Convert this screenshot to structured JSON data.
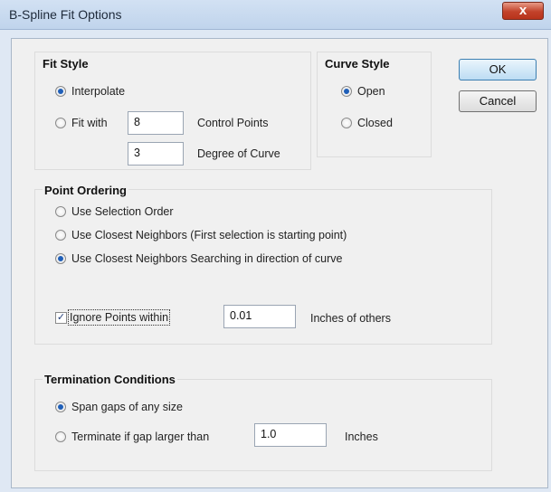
{
  "window": {
    "title": "B-Spline Fit Options",
    "close_label": "x"
  },
  "fit_style": {
    "title": "Fit Style",
    "interpolate_label": "Interpolate",
    "fit_with_label": "Fit with",
    "control_points_value": "8",
    "control_points_label": "Control Points",
    "degree_value": "3",
    "degree_label": "Degree of Curve",
    "selected": "interpolate"
  },
  "curve_style": {
    "title": "Curve Style",
    "open_label": "Open",
    "closed_label": "Closed",
    "selected": "open"
  },
  "buttons": {
    "ok_label": "OK",
    "cancel_label": "Cancel"
  },
  "point_ordering": {
    "title": "Point Ordering",
    "option1_label": "Use Selection Order",
    "option2_label": "Use Closest Neighbors (First selection is starting point)",
    "option3_label": "Use Closest Neighbors Searching in direction of curve",
    "selected": "option3",
    "ignore_checked": true,
    "ignore_label": "Ignore Points within",
    "ignore_value": "0.01",
    "ignore_suffix": "Inches of others"
  },
  "termination": {
    "title": "Termination Conditions",
    "span_label": "Span gaps of any size",
    "terminate_label": "Terminate if gap larger than",
    "gap_value": "1.0",
    "gap_suffix": "Inches",
    "selected": "span"
  }
}
